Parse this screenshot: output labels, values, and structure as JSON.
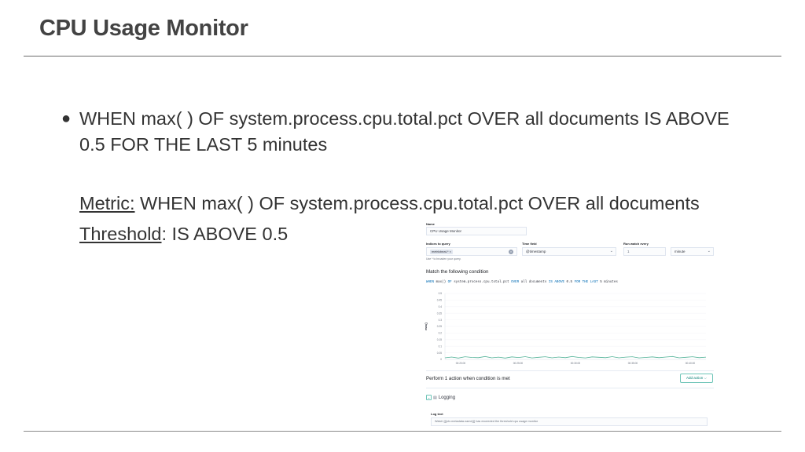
{
  "slide": {
    "title": "CPU Usage Monitor",
    "bullet": "WHEN max( ) OF system.process.cpu.total.pct OVER all documents IS ABOVE 0.5 FOR THE LAST 5 minutes",
    "metric_label": "Metric:",
    "metric_text": " WHEN max( ) OF system.process.cpu.total.pct OVER all documents",
    "threshold_label": "Threshold",
    "threshold_text": ": IS ABOVE 0.5"
  },
  "form": {
    "name_label": "Name",
    "name_value": "CPU Usage Monitor",
    "indices_label": "Indices to query",
    "indices_tag": "metricbeat-*",
    "indices_hint": "Use * to broaden your query.",
    "time_field_label": "Time field",
    "time_field_value": "@timestamp",
    "run_every_label": "Run watch every",
    "run_every_value": "1",
    "run_every_unit": "minute"
  },
  "condition": {
    "title": "Match the following condition",
    "when": "WHEN",
    "agg": "max()",
    "of": "OF",
    "field": "system.process.cpu.total.pct",
    "over": "OVER",
    "group": "all documents",
    "is": "IS ABOVE",
    "threshold": "0.5",
    "for_the_last": "FOR THE LAST",
    "window": "5 minutes"
  },
  "chart_data": {
    "type": "line",
    "ylabel": "max()",
    "yticks": [
      "0.5",
      "0.45",
      "0.4",
      "0.35",
      "0.3",
      "0.25",
      "0.2",
      "0.15",
      "0.1",
      "0.05",
      "0"
    ],
    "xticks": [
      "00:20:00",
      "00:25:00",
      "00:30:00",
      "00:35:00",
      "00:40:00"
    ],
    "ylim": [
      0,
      0.5
    ],
    "series": [
      {
        "color": "#54b399",
        "values": [
          0.012,
          0.018,
          0.01,
          0.02,
          0.015,
          0.013,
          0.022,
          0.012,
          0.017,
          0.01,
          0.019,
          0.014,
          0.021,
          0.011,
          0.016,
          0.02,
          0.012,
          0.018,
          0.013,
          0.022,
          0.015,
          0.011,
          0.019,
          0.016,
          0.013,
          0.021,
          0.012,
          0.017,
          0.02,
          0.011,
          0.015,
          0.019,
          0.013,
          0.018,
          0.022,
          0.012,
          0.016,
          0.02,
          0.013,
          0.017
        ]
      }
    ]
  },
  "actions": {
    "title": "Perform 1 action when condition is met",
    "add_button": "Add action",
    "logging_label": "Logging",
    "log_text_label": "Log text",
    "log_text_value": "Watch [{{ctx.metadata.name}}] has exceeded the threshold cpu usage monitor"
  }
}
